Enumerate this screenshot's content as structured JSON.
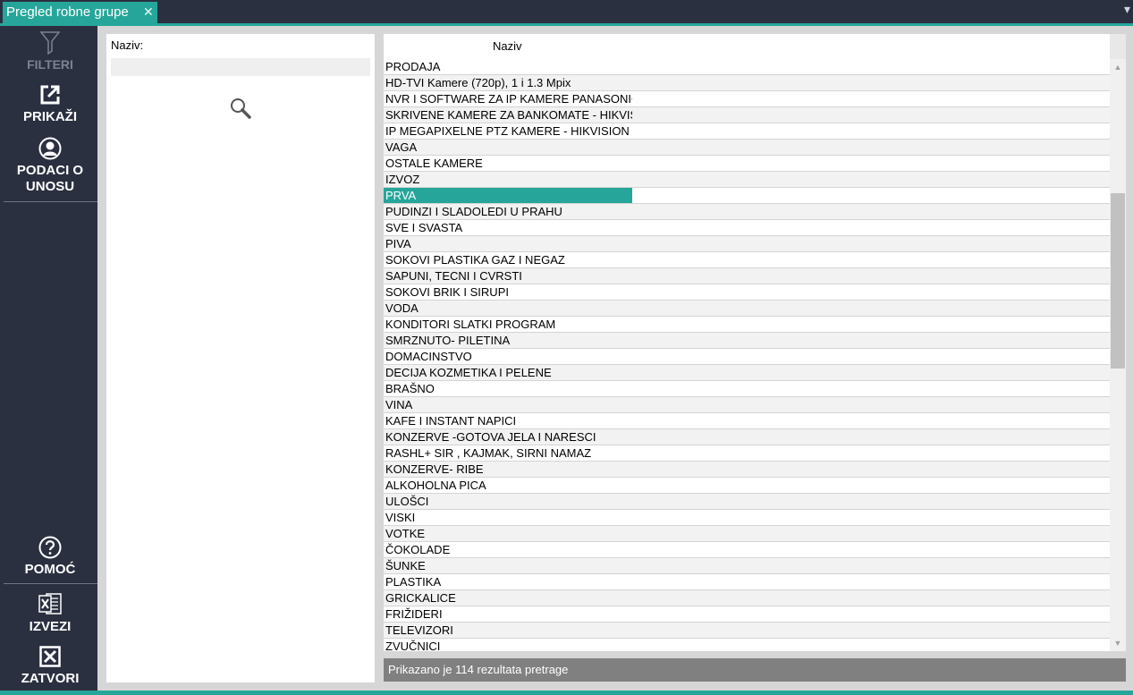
{
  "window": {
    "tab_title": "Pregled robne grupe",
    "tab_close": "✕",
    "menu_glyph": "▾"
  },
  "sidebar": {
    "filteri": "FILTERI",
    "prikazi": "PRIKAŽI",
    "podaci": "PODACI O UNOSU",
    "pomoc": "POMOĆ",
    "izvezi": "IZVEZI",
    "zatvori": "ZATVORI"
  },
  "filter": {
    "label": "Naziv:",
    "value": ""
  },
  "list": {
    "header": "Naziv",
    "selected_index": 8,
    "rows": [
      "PRODAJA",
      "HD-TVI Kamere (720p), 1 i 1.3 Mpix",
      "NVR I SOFTWARE ZA IP KAMERE PANASONIC",
      "SKRIVENE KAMERE ZA BANKOMATE - HIKVISION",
      "IP MEGAPIXELNE PTZ KAMERE - HIKVISION",
      "VAGA",
      "OSTALE KAMERE",
      "IZVOZ",
      "PRVA",
      "PUDINZI I SLADOLEDI U PRAHU",
      "SVE I SVASTA",
      "PIVA",
      "SOKOVI  PLASTIKA GAZ I NEGAZ",
      "SAPUNI, TECNI I CVRSTI",
      "SOKOVI BRIK I SIRUPI",
      "VODA",
      "KONDITORI SLATKI PROGRAM",
      "SMRZNUTO- PILETINA",
      "DOMACINSTVO",
      "DECIJA  KOZMETIKA I PELENE",
      "BRAŠNO",
      "VINA",
      "KAFE I INSTANT NAPICI",
      "KONZERVE -GOTOVA JELA I NARESCI",
      "RASHL+ SIR , KAJMAK, SIRNI NAMAZ",
      "KONZERVE- RIBE",
      "ALKOHOLNA PICA",
      "ULOŠCI",
      "VISKI",
      "VOTKE",
      "ČOKOLADE",
      "ŠUNKE",
      "PLASTIKA",
      "GRICKALICE",
      "FRIŽIDERI",
      "TELEVIZORI",
      "ZVUČNICI"
    ],
    "scroll_up": "▲",
    "scroll_down": "▼"
  },
  "status": {
    "text": "Prikazano je 114 rezultata pretrage"
  },
  "colors": {
    "accent": "#26a69a",
    "sidebar_bg": "#2b3040",
    "status_bg": "#808080"
  }
}
